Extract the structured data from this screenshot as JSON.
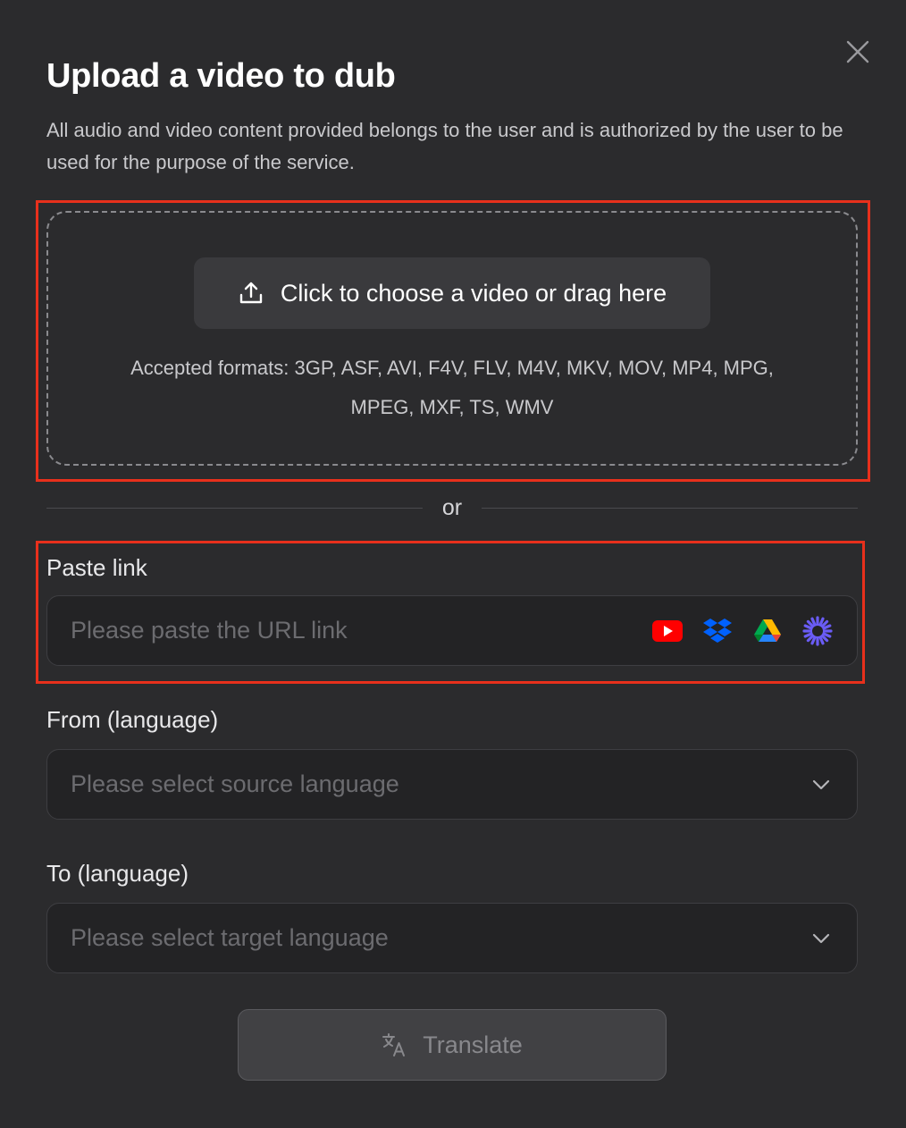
{
  "dialog": {
    "title": "Upload a video to dub",
    "subtitle": "All audio and video content provided belongs to the user and is authorized by the user to be used for the purpose of the service."
  },
  "upload": {
    "button_label": "Click to choose a video or drag here",
    "accepted_formats": "Accepted formats: 3GP, ASF, AVI, F4V, FLV, M4V, MKV, MOV, MP4, MPG, MPEG, MXF, TS, WMV"
  },
  "divider": {
    "text": "or"
  },
  "paste_link": {
    "label": "Paste link",
    "placeholder": "Please paste the URL link",
    "services": [
      "youtube-icon",
      "dropbox-icon",
      "google-drive-icon",
      "starburst-icon"
    ]
  },
  "from_language": {
    "label": "From (language)",
    "placeholder": "Please select source language"
  },
  "to_language": {
    "label": "To (language)",
    "placeholder": "Please select target language"
  },
  "translate": {
    "label": "Translate",
    "enabled": false
  },
  "colors": {
    "background": "#2b2b2d",
    "field_bg": "#232325",
    "highlight": "#e8301c",
    "youtube": "#ff0000",
    "dropbox": "#0061fe",
    "starburst": "#6a5cf6"
  }
}
